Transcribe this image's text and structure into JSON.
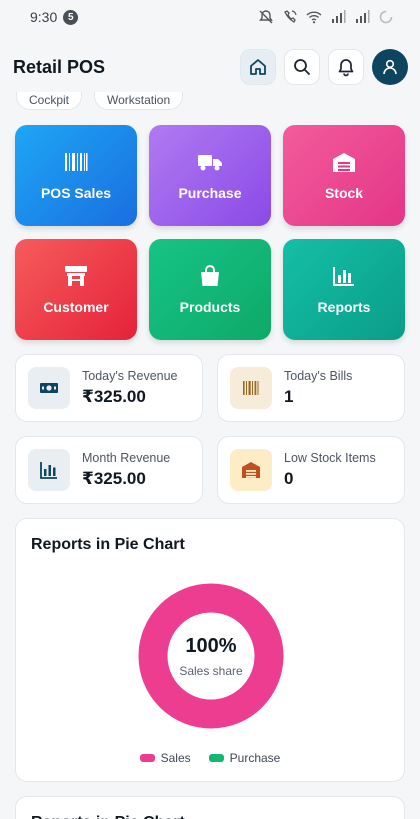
{
  "status": {
    "time": "9:30",
    "badge": "5"
  },
  "header": {
    "title": "Retail POS"
  },
  "chips": [
    "Cockpit",
    "Workstation"
  ],
  "tiles": [
    {
      "label": "POS Sales",
      "icon": "barcode-icon",
      "color_from": "#1ea7f5",
      "color_to": "#1a6ee0"
    },
    {
      "label": "Purchase",
      "icon": "truck-icon",
      "color_from": "#b17af2",
      "color_to": "#8a4ae6"
    },
    {
      "label": "Stock",
      "icon": "warehouse-icon",
      "color_from": "#f25c9c",
      "color_to": "#e43586"
    },
    {
      "label": "Customer",
      "icon": "store-icon",
      "color_from": "#f55c5c",
      "color_to": "#e5223a"
    },
    {
      "label": "Products",
      "icon": "shopping-bag-icon",
      "color_from": "#16c485",
      "color_to": "#0ea968"
    },
    {
      "label": "Reports",
      "icon": "bar-chart-icon",
      "color_from": "#14bfa6",
      "color_to": "#0a9d88"
    }
  ],
  "stats": [
    {
      "label": "Today's Revenue",
      "value": "₹325.00",
      "icon": "cash-icon",
      "bg": "#e9eef2"
    },
    {
      "label": "Today's Bills",
      "value": "1",
      "icon": "barcode-icon",
      "bg": "#f7ecd9"
    },
    {
      "label": "Month Revenue",
      "value": "₹325.00",
      "icon": "bar-chart-icon",
      "bg": "#e9eef2"
    },
    {
      "label": "Low Stock Items",
      "value": "0",
      "icon": "warehouse-icon",
      "bg": "#fdedc7"
    }
  ],
  "pie_card": {
    "title": "Reports in Pie Chart",
    "center_value": "100%",
    "center_label": "Sales share",
    "legend": [
      {
        "name": "Sales",
        "color": "#ec3d91"
      },
      {
        "name": "Purchase",
        "color": "#12b871"
      }
    ]
  },
  "chart_data": {
    "type": "pie",
    "categories": [
      "Sales",
      "Purchase"
    ],
    "values": [
      100,
      0
    ],
    "title": "Reports in Pie Chart"
  },
  "second_card": {
    "title": "Reports in Pie Chart"
  }
}
